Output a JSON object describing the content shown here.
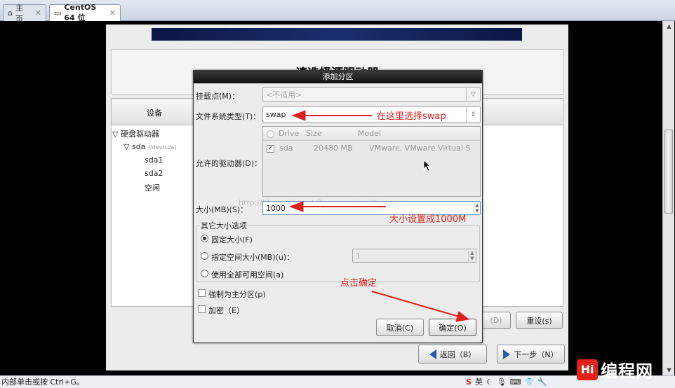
{
  "browser": {
    "tabs": [
      {
        "label": "主页",
        "icon": "home-icon"
      },
      {
        "label": "CentOS 64 位",
        "icon": "vm-icon"
      }
    ],
    "status_text": "内部单击或按 Ctrl+G。",
    "tray_text": "英",
    "watermark": "http://blog.csdn.net/ProgrammingWay",
    "logo_text": "编程网",
    "logo_mark": "Hi"
  },
  "installer": {
    "title": "请选择源驱动器",
    "device_column": "设备",
    "tree": [
      {
        "label": "硬盘驱动器",
        "level": 0,
        "expander": "▽"
      },
      {
        "label": "sda",
        "sub": "(/dev/sda)",
        "level": 1,
        "expander": "▽"
      },
      {
        "label": "sda1",
        "level": 2
      },
      {
        "label": "sda2",
        "level": 2
      },
      {
        "label": "空闲",
        "level": 2
      }
    ],
    "btn_edit": "(D)",
    "btn_reset": "重设(s)",
    "btn_back": "返回（B）",
    "btn_next": "下一步（N）"
  },
  "dialog": {
    "title": "添加分区",
    "mountpoint_label": "挂载点(M)：",
    "mountpoint_value": "<不适用>",
    "fstype_label": "文件系统类型(T)：",
    "fstype_value": "swap",
    "drives_label": "允许的驱动器(D)：",
    "drives_header": [
      "Drive",
      "Size",
      "Model"
    ],
    "drives_rows": [
      {
        "drive": "sda",
        "size": "20480 MB",
        "model": "VMware, VMware Virtual S",
        "checked": true
      }
    ],
    "size_label": "大小(MB)(S)：",
    "size_value": "1000",
    "other_size_title": "其它大小选项",
    "size_options": [
      {
        "label": "固定大小(F)",
        "selected": true
      },
      {
        "label": "指定空间大小(MB)(u)：",
        "selected": false
      },
      {
        "label": "使用全部可用空间(a)",
        "selected": false
      }
    ],
    "max_size_value": "1",
    "force_primary_label": "強制为主分区(p)",
    "encrypt_label": "加密（E）",
    "cancel_label": "取消(C)",
    "ok_label": "确定(O)"
  },
  "annotations": {
    "fstype_note": "在这里选择swap",
    "size_note": "大小设置成1000M",
    "ok_note": "点击确定",
    "color": "#e0211c"
  }
}
